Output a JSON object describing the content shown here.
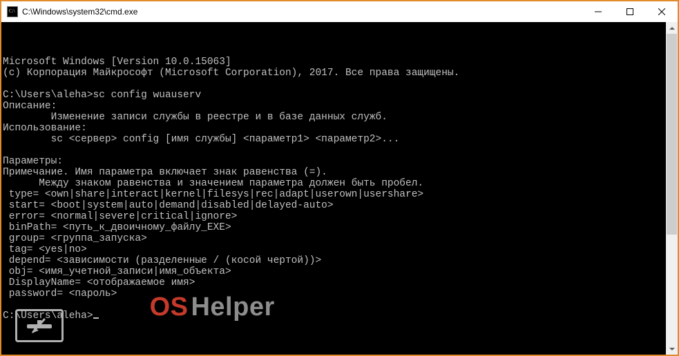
{
  "window": {
    "title": "C:\\Windows\\system32\\cmd.exe"
  },
  "terminal": {
    "lines": [
      "Microsoft Windows [Version 10.0.15063]",
      "(c) Корпорация Майкрософт (Microsoft Corporation), 2017. Все права защищены.",
      "",
      "C:\\Users\\aleha>sc config wuauserv",
      "Описание:",
      "        Изменение записи службы в реестре и в базе данных служб.",
      "Использование:",
      "        sc <сервер> config [имя службы] <параметр1> <параметр2>...",
      "",
      "Параметры:",
      "Примечание. Имя параметра включает знак равенства (=).",
      "      Между знаком равенства и значением параметра должен быть пробел.",
      " type= <own|share|interact|kernel|filesys|rec|adapt|userown|usershare>",
      " start= <boot|system|auto|demand|disabled|delayed-auto>",
      " error= <normal|severe|critical|ignore>",
      " binPath= <путь_к_двоичному_файлу_EXE>",
      " group= <группа_запуска>",
      " tag= <yes|no>",
      " depend= <зависимости (разделенные / (косой чертой))>",
      " obj= <имя_учетной_записи|имя_объекта>",
      " DisplayName= <отображаемое имя>",
      " password= <пароль>",
      ""
    ],
    "prompt": "C:\\Users\\aleha>"
  },
  "watermark": {
    "part1": "OS",
    "part2": "Helper"
  }
}
